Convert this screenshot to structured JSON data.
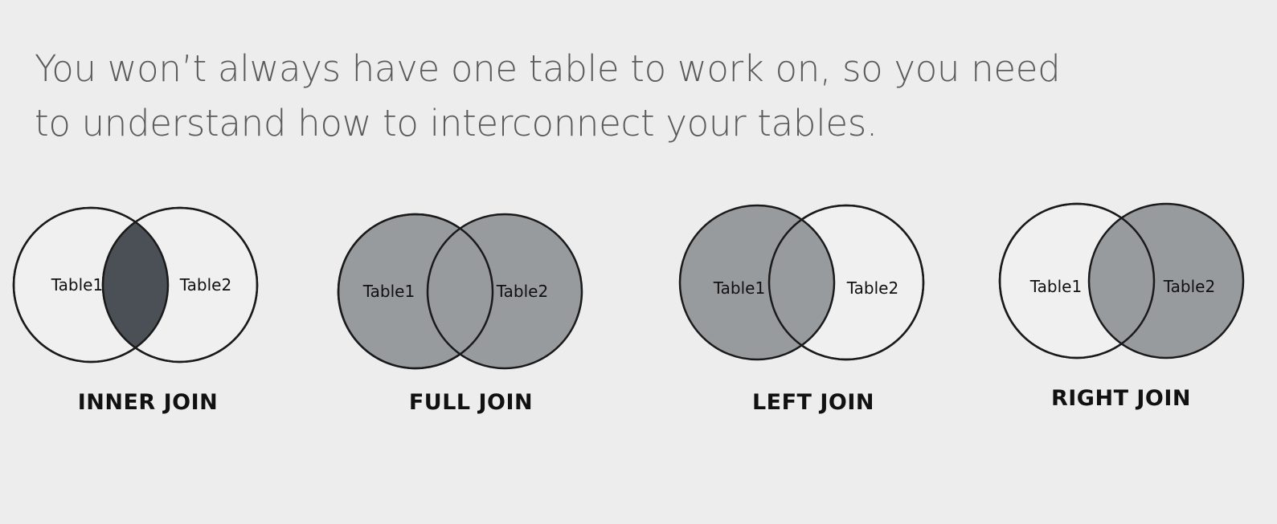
{
  "intro_text": "You won’t always have one table to work on, so you need to understand how to interconnect your tables.",
  "colors": {
    "background": "#ededed",
    "inner_fill": "#4b5056",
    "highlight_fill": "#989b9e",
    "outline": "#1a1a1a",
    "text": "#5b5b5b"
  },
  "diagrams": [
    {
      "title": "INNER JOIN",
      "left_label": "Table1",
      "right_label": "Table2"
    },
    {
      "title": "FULL JOIN",
      "left_label": "Table1",
      "right_label": "Table2"
    },
    {
      "title": "LEFT JOIN",
      "left_label": "Table1",
      "right_label": "Table2"
    },
    {
      "title": "RIGHT JOIN",
      "left_label": "Table1",
      "right_label": "Table2"
    }
  ]
}
